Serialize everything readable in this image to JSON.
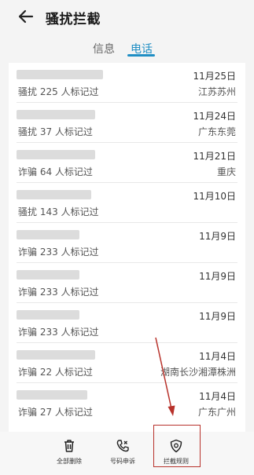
{
  "header": {
    "title": "骚扰拦截",
    "back_icon": "arrow-left-icon"
  },
  "tabs": [
    {
      "label": "信息",
      "active": false
    },
    {
      "label": "电话",
      "active": true
    }
  ],
  "calls": [
    {
      "label": "骚扰  225 人标记过",
      "date": "11月25日",
      "location": "江苏苏州"
    },
    {
      "label": "骚扰  37 人标记过",
      "date": "11月24日",
      "location": "广东东莞"
    },
    {
      "label": "诈骗  64 人标记过",
      "date": "11月21日",
      "location": "重庆"
    },
    {
      "label": "骚扰  143 人标记过",
      "date": "11月10日",
      "location": ""
    },
    {
      "label": "诈骗  233 人标记过",
      "date": "11月9日",
      "location": ""
    },
    {
      "label": "诈骗  233 人标记过",
      "date": "11月9日",
      "location": ""
    },
    {
      "label": "诈骗  233 人标记过",
      "date": "11月9日",
      "location": ""
    },
    {
      "label": "诈骗  22 人标记过",
      "date": "11月4日",
      "location": "湖南长沙湘潭株洲"
    },
    {
      "label": "诈骗  27 人标记过",
      "date": "11月4日",
      "location": "广东广州"
    }
  ],
  "bottom_bar": [
    {
      "label": "全部删除",
      "icon": "trash-icon"
    },
    {
      "label": "号码申诉",
      "icon": "phone-appeal-icon"
    },
    {
      "label": "拦截规则",
      "icon": "shield-rules-icon"
    }
  ],
  "colors": {
    "accent": "#1f8ec4",
    "annotation": "#b8322b"
  }
}
